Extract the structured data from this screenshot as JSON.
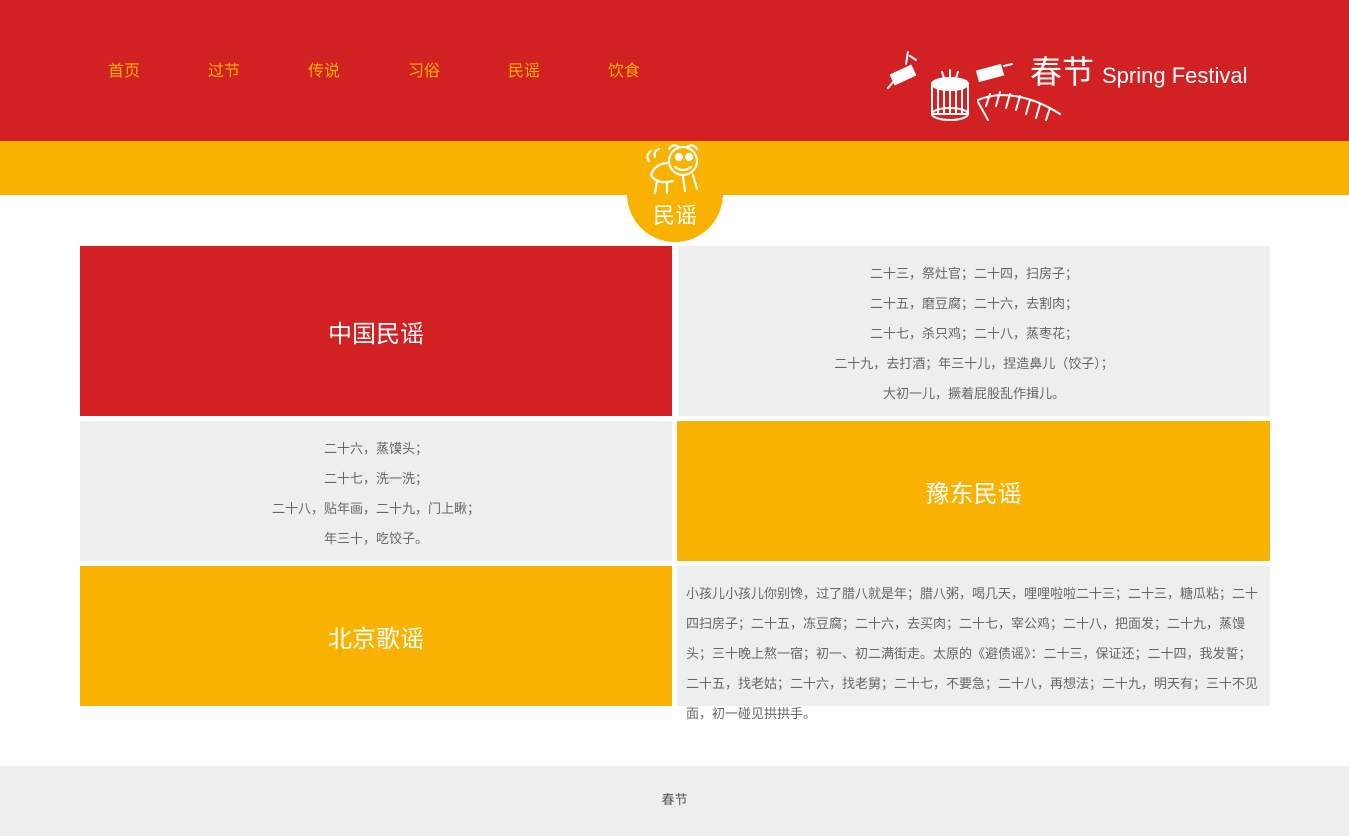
{
  "nav": {
    "items": [
      {
        "label": "首页"
      },
      {
        "label": "过节"
      },
      {
        "label": "传说"
      },
      {
        "label": "习俗"
      },
      {
        "label": "民谣"
      },
      {
        "label": "饮食"
      }
    ]
  },
  "brand": {
    "title_cn": "春节",
    "title_en": "Spring Festival"
  },
  "section": {
    "badge_label": "民谣"
  },
  "cards": {
    "china_title": "中国民谣",
    "china_lines": [
      "二十三，祭灶官；二十四，扫房子；",
      "二十五，磨豆腐；二十六，去割肉；",
      "二十七，杀只鸡；二十八，蒸枣花；",
      "二十九，去打酒；年三十儿，捏造鼻儿（饺子）；",
      "大初一儿，撅着屁股乱作揖儿。"
    ],
    "yudong_lines": [
      "二十六，蒸馍头；",
      "二十七，洗一洗；",
      "二十八，贴年画，二十九，门上瞅；",
      "年三十，吃饺子。"
    ],
    "yudong_title": "豫东民谣",
    "beijing_title": "北京歌谣",
    "beijing_text": "小孩儿小孩儿你别馋，过了腊八就是年；腊八粥，喝几天，哩哩啦啦二十三；二十三，糖瓜粘；二十四扫房子；二十五，冻豆腐；二十六，去买肉；二十七，宰公鸡；二十八，把面发；二十九，蒸馒头；三十晚上熬一宿；初一、初二满街走。太原的《避债谣》：二十三，保证还；二十四，我发誓；二十五，找老姑；二十六，找老舅；二十七，不要急；二十八，再想法；二十九，明天有；三十不见面，初一碰见拱拱手。"
  },
  "footer": {
    "text": "春节"
  },
  "colors": {
    "red": "#d12123",
    "yellow": "#f9b200",
    "grey": "#eeeeee"
  },
  "icons": {
    "brand": "firecracker-drum-illustration",
    "badge": "lion-dance-icon"
  }
}
